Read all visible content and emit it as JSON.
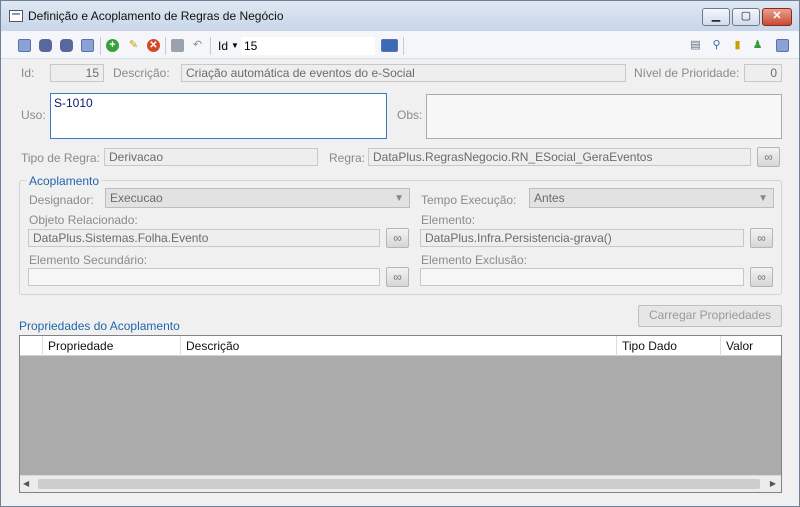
{
  "window": {
    "title": "Definição e Acoplamento de Regras de Negócio",
    "minimize_glyph": "▁",
    "maximize_glyph": "▢",
    "close_glyph": "✕"
  },
  "toolbar": {
    "id_label": "Id",
    "id_value": "15"
  },
  "form": {
    "id_label": "Id:",
    "id_value": "15",
    "descricao_label": "Descrição:",
    "descricao_value": "Criação automática de eventos do e-Social",
    "prioridade_label": "Nível de Prioridade:",
    "prioridade_value": "0",
    "uso_label": "Uso:",
    "uso_value": "S-1010",
    "obs_label": "Obs:",
    "obs_value": "",
    "tipo_regra_label": "Tipo de Regra:",
    "tipo_regra_value": "Derivacao",
    "regra_label": "Regra:",
    "regra_value": "DataPlus.RegrasNegocio.RN_ESocial_GeraEventos"
  },
  "acoplamento": {
    "title": "Acoplamento",
    "designador_label": "Designador:",
    "designador_value": "Execucao",
    "tempo_label": "Tempo Execução:",
    "tempo_value": "Antes",
    "objeto_label": "Objeto Relacionado:",
    "objeto_value": "DataPlus.Sistemas.Folha.Evento",
    "elemento_label": "Elemento:",
    "elemento_value": "DataPlus.Infra.Persistencia-grava()",
    "elem_sec_label": "Elemento Secundário:",
    "elem_sec_value": "",
    "elem_exc_label": "Elemento Exclusão:",
    "elem_exc_value": ""
  },
  "propriedades": {
    "title": "Propriedades do Acoplamento",
    "carregar_label": "Carregar Propriedades",
    "columns": [
      "Propriedade",
      "Descrição",
      "Tipo Dado",
      "Valor"
    ],
    "rows": []
  },
  "colors": {
    "accent": "#2266aa",
    "focus_border": "#3a78c8",
    "grid_empty": "#ababab"
  }
}
